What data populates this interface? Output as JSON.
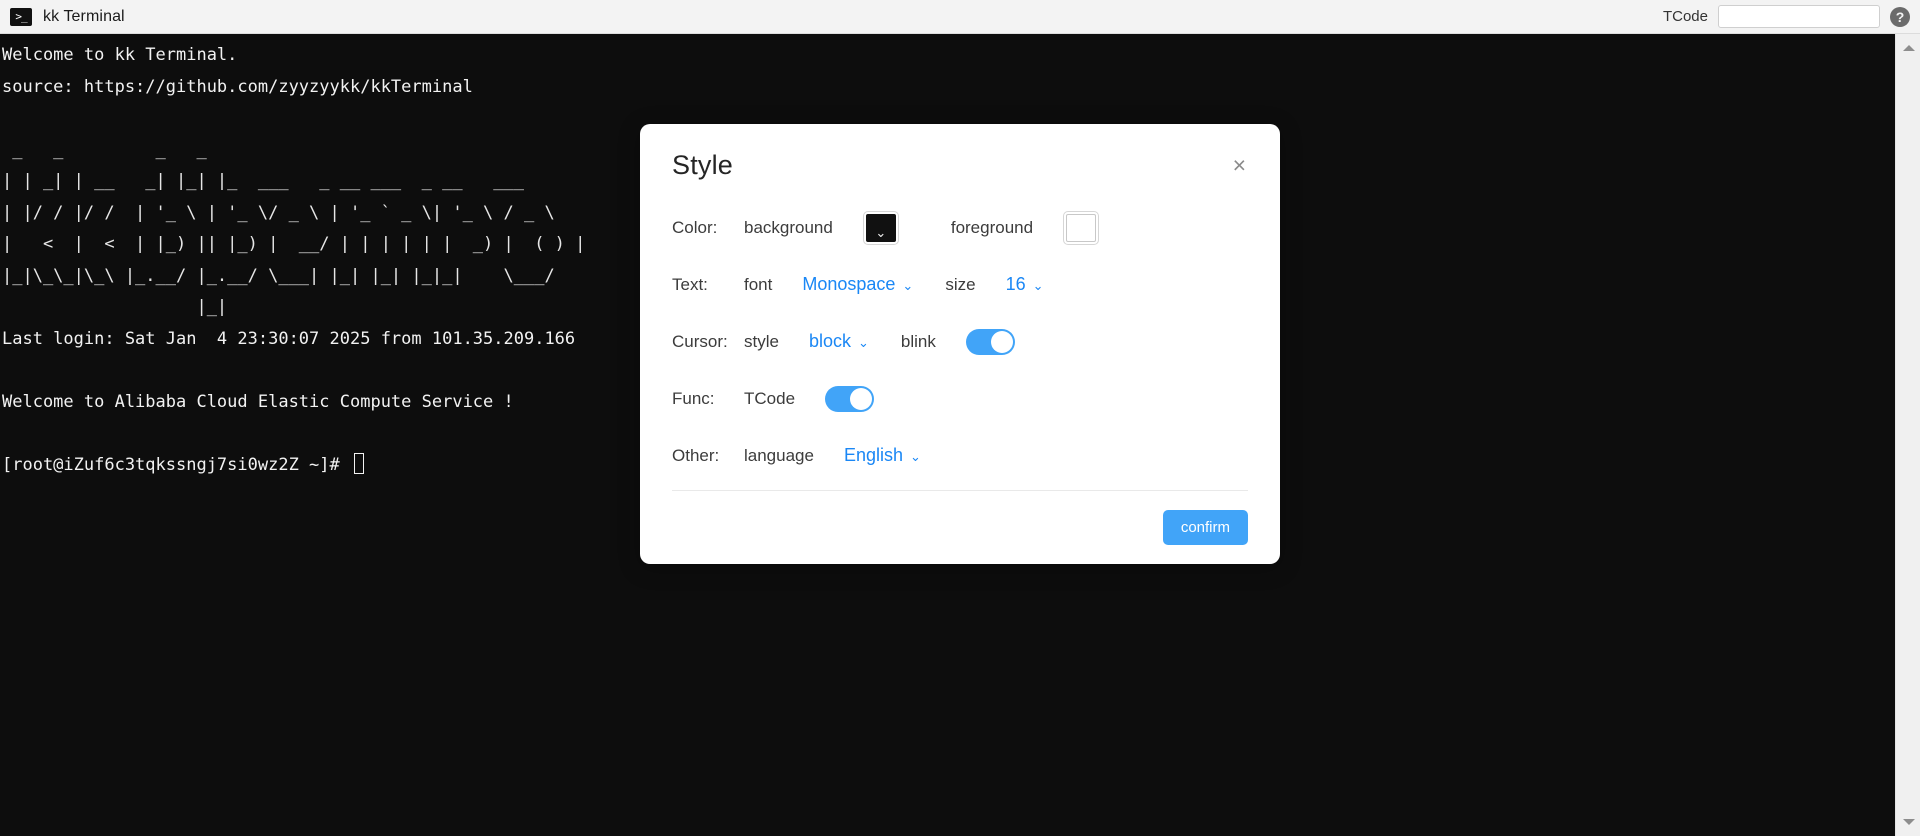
{
  "titlebar": {
    "icon": "terminal-prompt-icon",
    "icon_glyph": ">_",
    "title": "kk Terminal",
    "tcode_label": "TCode",
    "tcode_value": "",
    "tcode_placeholder": "",
    "help_glyph": "?"
  },
  "terminal": {
    "background": "#0d0d0d",
    "foreground": "#f2f2f2",
    "lines": [
      "Welcome to kk Terminal.",
      "source: https://github.com/zyyzyykk/kkTerminal",
      "",
      " _   _         _   _",
      "| | _| | __   _| |_| |_  ___   _ __ ___  _ __   ___",
      "| |/ / |/ /  | '_ \\ | '_ \\/ _ \\ | '_ ` _ \\| '_ \\ / _ \\",
      "|   <  |  <  | |_) || |_) |  __/ | | | | | |  _) |  ( ) |",
      "|_|\\_\\_|\\_\\ |_.__/ |_.__/ \\___| |_| |_| |_|_|    \\___/",
      "                   |_|",
      "Last login: Sat Jan  4 23:30:07 2025 from 101.35.209.166",
      "",
      "Welcome to Alibaba Cloud Elastic Compute Service !",
      "",
      "[root@iZuf6c3tqkssngj7si0wz2Z ~]# "
    ],
    "prompt": "[root@iZuf6c3tqkssngj7si0wz2Z ~]# ",
    "cursor_style": "block"
  },
  "scrollbar": {
    "up_arrow": "triangle-up-icon",
    "down_arrow": "triangle-down-icon"
  },
  "modal": {
    "title": "Style",
    "close_glyph": "×",
    "rows": {
      "color": {
        "label": "Color:",
        "background_label": "background",
        "background_value": "#111111",
        "background_chevron": "⌄",
        "foreground_label": "foreground",
        "foreground_value": "#ffffff"
      },
      "text": {
        "label": "Text:",
        "font_label": "font",
        "font_value": "Monospace",
        "size_label": "size",
        "size_value": "16"
      },
      "cursor": {
        "label": "Cursor:",
        "style_label": "style",
        "style_value": "block",
        "blink_label": "blink",
        "blink_on": true
      },
      "func": {
        "label": "Func:",
        "tcode_label": "TCode",
        "tcode_on": true
      },
      "other": {
        "label": "Other:",
        "language_label": "language",
        "language_value": "English"
      }
    },
    "confirm_label": "confirm",
    "accent_color": "#41a4f8",
    "link_color": "#1a87f5",
    "chevron_glyph": "⌄"
  }
}
